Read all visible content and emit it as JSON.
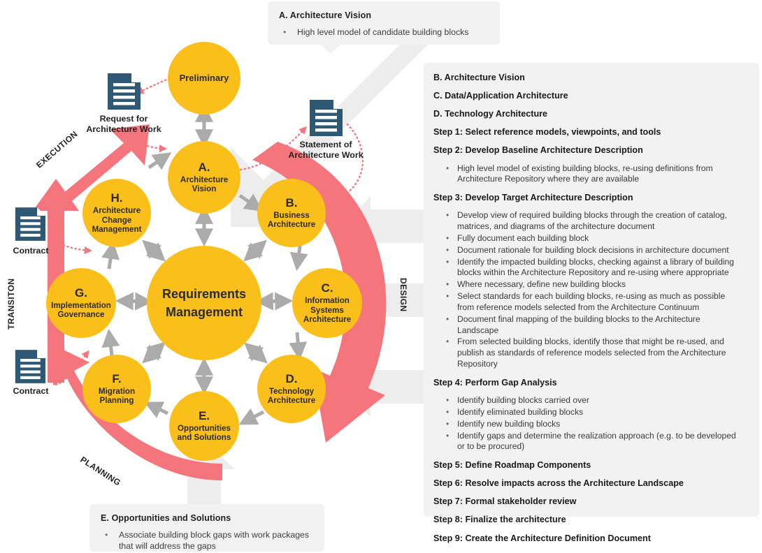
{
  "diagram": {
    "title": "TOGAF ADM Cycle",
    "colors": {
      "circle_fill": "#FBBF1C",
      "circle_text": "#2b2b2b",
      "coral_arrow": "#F4757C",
      "doc_icon": "#2E5873",
      "grey_arrow": "#ABABAB",
      "panel_bg": "#f2f2f2",
      "wide_grey_arrow": "#EDEDED"
    },
    "phases": [
      {
        "id": "preliminary",
        "letter": "",
        "label": "Preliminary"
      },
      {
        "id": "a",
        "letter": "A.",
        "label": "Architecture\nVision"
      },
      {
        "id": "b",
        "letter": "B.",
        "label": "Business\nArchitecture"
      },
      {
        "id": "c",
        "letter": "C.",
        "label": "Information\nSystems\nArchitecture"
      },
      {
        "id": "d",
        "letter": "D.",
        "label": "Technology\nArchitecture"
      },
      {
        "id": "e",
        "letter": "E.",
        "label": "Opportunities\nand Solutions"
      },
      {
        "id": "f",
        "letter": "F.",
        "label": "Migration\nPlanning"
      },
      {
        "id": "g",
        "letter": "G.",
        "label": "Implementation\nGovernance"
      },
      {
        "id": "h",
        "letter": "H.",
        "label": "Architecture\nChange\nManagement"
      },
      {
        "id": "center",
        "letter": "",
        "label": "Requirements\nManagement"
      }
    ],
    "documents": [
      {
        "id": "request",
        "label": "Request for\nArchitecture Work"
      },
      {
        "id": "statement",
        "label": "Statement of\nArchitecture Work"
      },
      {
        "id": "contract-upper",
        "label": "Contract"
      },
      {
        "id": "contract-lower",
        "label": "Contract"
      }
    ],
    "band_labels": [
      {
        "id": "execution",
        "text": "EXECUTION"
      },
      {
        "id": "transiton",
        "text": "TRANSITON"
      },
      {
        "id": "planning",
        "text": "PLANNING"
      },
      {
        "id": "design",
        "text": "DESIGN"
      }
    ]
  },
  "callout_top": {
    "title": "A. Architecture Vision",
    "bullet": "•",
    "items": [
      "High level model of candidate building blocks"
    ]
  },
  "callout_bottom": {
    "title": "E. Opportunities and Solutions",
    "bullet": "•",
    "items": [
      "Associate building block gaps with work packages that will address the gaps"
    ]
  },
  "info_panel": {
    "bullet": "•",
    "headings": {
      "b": "B. Architecture Vision",
      "c": "C. Data/Application Architecture",
      "d": "D. Technology Architecture",
      "step1": "Step 1: Select reference models, viewpoints, and tools",
      "step2": "Step 2: Develop Baseline Architecture Description",
      "step3": "Step 3: Develop Target Architecture Description",
      "step4": "Step 4: Perform Gap Analysis",
      "step5": "Step 5: Define Roadmap Components",
      "step6": "Step 6: Resolve impacts across the Architecture Landscape",
      "step7": "Step 7: Formal stakeholder review",
      "step8": "Step 8: Finalize the architecture",
      "step9": "Step 9: Create the Architecture Definition Document"
    },
    "step2_items": [
      "High level model of existing building blocks, re-using definitions from Architecture Repository where they are available"
    ],
    "step3_items": [
      "Develop view of required building blocks through the creation of catalog, matrices, and diagrams of the architecture document",
      "Fully document each building block",
      "Document rationale for building block decisions in architecture document",
      "Identify the impacted building blocks, checking against a library of building blocks within the Architecture Repository and re-using where appropriate",
      "Where necessary, define new building blocks",
      "Select standards for each building blocks, re-using as much as possible from reference models selected from the Architecture Continuum",
      "Document final mapping of the building blocks to the Architecture Landscape",
      "From selected building blocks, identify those that might be re-used, and publish as standards of reference models selected from the Architecture Repository"
    ],
    "step4_items": [
      "Identify building blocks carried over",
      "Identify eliminated building blocks",
      "Identify new building blocks",
      "Identify gaps and determine the realization approach (e.g. to be developed or to be procured)"
    ]
  }
}
